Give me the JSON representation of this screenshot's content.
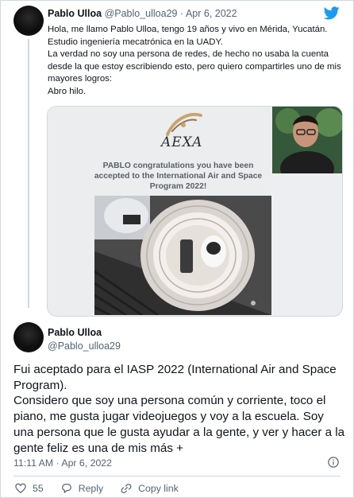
{
  "tweet": {
    "author_name": "Pablo Ulloa",
    "author_handle": "@Pablo_ulloa29",
    "separator": "·",
    "date": "Apr 6, 2022",
    "lines": [
      "Hola, me llamo Pablo Ulloa, tengo 19 años y vivo en Mérida, Yucatán.",
      "Estudio ingeniería mecatrónica en la UADY.",
      "La verdad no soy una persona de redes, de hecho no usaba la cuenta desde la que estoy escribiendo esto, pero quiero compartirles uno de mis mayores logros:",
      "Abro hilo."
    ],
    "media": {
      "logo_text": "AEXA",
      "congrats_text": "PABLO congratulations you have been accepted to the International Air and Space Program 2022!"
    }
  },
  "reply": {
    "author_name": "Pablo Ulloa",
    "author_handle": "@Pablo_ulloa29",
    "lines": [
      "Fui aceptado para el IASP 2022 (International Air and Space Program).",
      "Considero que soy una persona común y corriente, toco el piano, me gusta jugar videojuegos y voy a la escuela. Soy una persona que le gusta ayudar a la gente, y ver y hacer a la gente feliz es una de mis más +"
    ],
    "timestamp": "11:11 AM · Apr 6, 2022",
    "likes_count": "55",
    "reply_label": "Reply",
    "copy_link_label": "Copy link"
  },
  "colors": {
    "twitter_blue": "#1d9bf0",
    "text_primary": "#0f1419",
    "text_muted": "#536471",
    "border": "#cfd9de"
  },
  "icons": [
    "twitter-bird-icon",
    "info-icon",
    "heart-icon",
    "reply-icon",
    "link-icon"
  ]
}
